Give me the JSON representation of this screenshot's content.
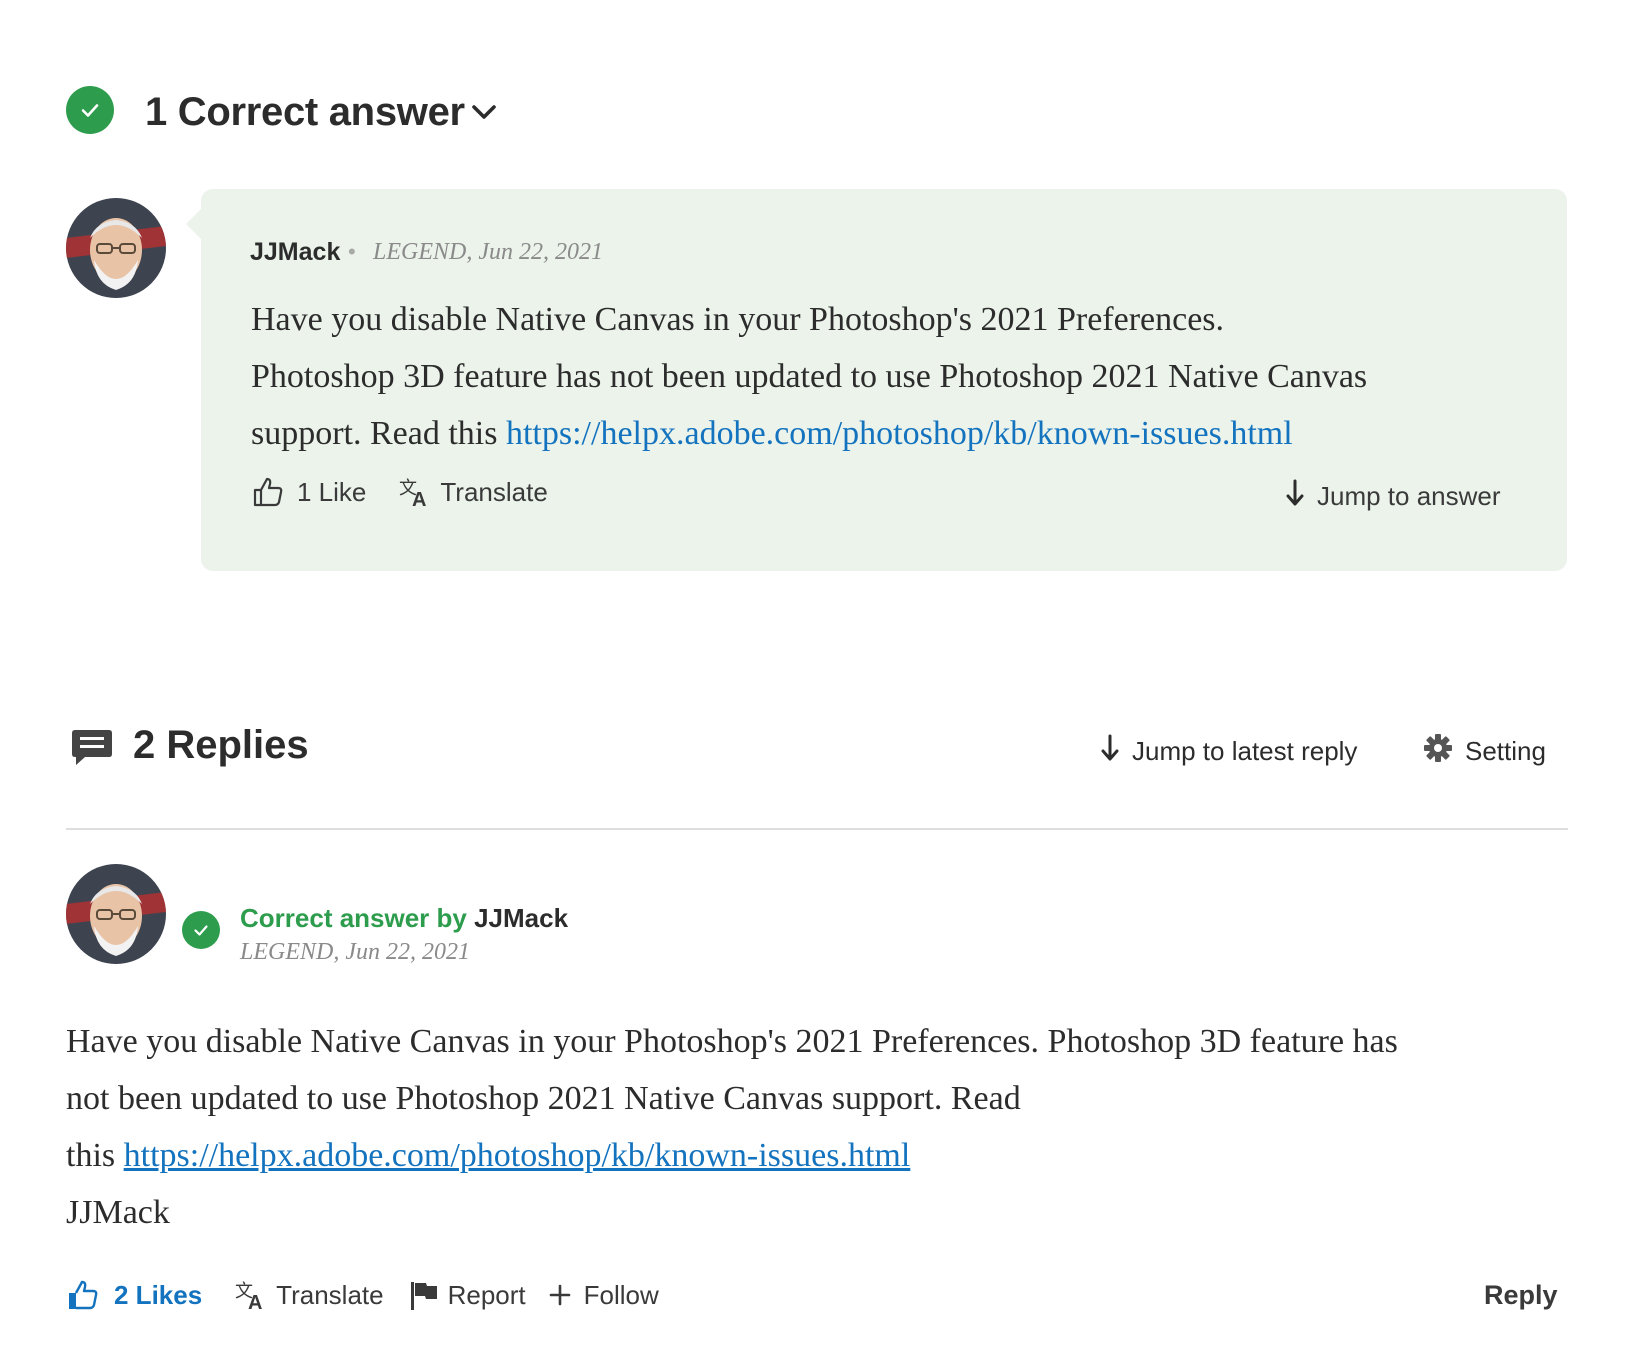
{
  "correct_answer_section": {
    "title": "1 Correct answer"
  },
  "answer_preview": {
    "author": "JJMack",
    "separator": "•",
    "meta": "LEGEND, Jun 22, 2021",
    "body_line_1": "Have you disable Native Canvas in your Photoshop's 2021 Preferences.",
    "body_line_2": "Photoshop 3D feature has not been updated to use Photoshop 2021 Native Canvas",
    "body_line_3": "support. Read this ",
    "link": "https://helpx.adobe.com/photoshop/kb/known-issues.html",
    "likes_label": "1 Like",
    "translate_label": "Translate",
    "jump_label": "Jump to answer"
  },
  "replies_section": {
    "title": "2 Replies",
    "jump_latest_label": "Jump to latest reply",
    "setting_label": "Setting"
  },
  "reply_post": {
    "correct_answer_prefix": "Correct answer by ",
    "author": "JJMack",
    "meta": "LEGEND, Jun 22, 2021",
    "body_line_1": "Have you disable Native Canvas in your Photoshop's 2021 Preferences. Photoshop 3D feature has",
    "body_line_2": "not been updated to use Photoshop 2021 Native Canvas support. Read",
    "body_line_3": "this ",
    "link": "https://helpx.adobe.com/photoshop/kb/known-issues.html",
    "signature": "JJMack",
    "likes_label": "2 Likes",
    "translate_label": "Translate",
    "report_label": "Report",
    "follow_label": "Follow",
    "reply_label": "Reply"
  },
  "colors": {
    "success_green": "#2d9d4d",
    "answer_bg": "#ebf3eb",
    "link_blue": "#1473be",
    "text_dark": "#2c2c2c"
  }
}
